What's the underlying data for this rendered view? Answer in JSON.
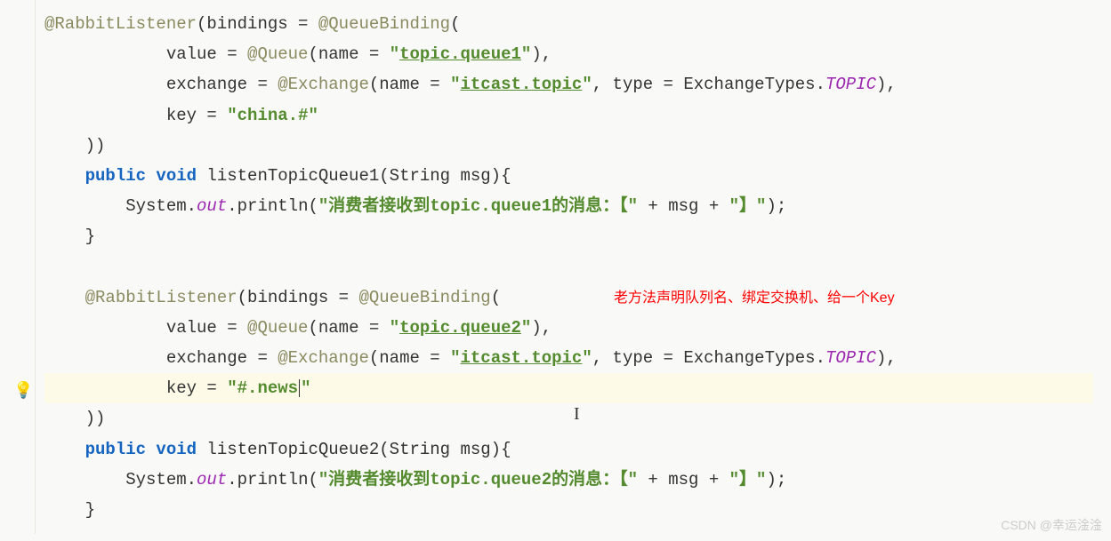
{
  "code": {
    "line1_anno": "@RabbitListener",
    "line1_rest": "(bindings = ",
    "line1_anno2": "@QueueBinding",
    "line1_paren": "(",
    "line2_pre": "            value = ",
    "line2_anno": "@Queue",
    "line2_mid": "(name = ",
    "line2_str_q": "\"",
    "line2_str": "topic.queue1",
    "line2_end": "),",
    "line3_pre": "            exchange = ",
    "line3_anno": "@Exchange",
    "line3_mid": "(name = ",
    "line3_str_q": "\"",
    "line3_str": "itcast.topic",
    "line3_mid2": ", type = ExchangeTypes.",
    "line3_topic": "TOPIC",
    "line3_end": "),",
    "line4_pre": "            key = ",
    "line4_str": "\"china.#\"",
    "line5": "    ))",
    "line6_kw": "public void",
    "line6_rest": " listenTopicQueue1(String msg){",
    "line7_pre": "        System.",
    "line7_out": "out",
    "line7_mid": ".println(",
    "line7_str": "\"消费者接收到topic.queue1的消息：【\"",
    "line7_mid2": " + msg + ",
    "line7_str2": "\"】\"",
    "line7_end": ");",
    "line8": "    }",
    "line9": "",
    "line10_anno": "@RabbitListener",
    "line10_rest": "(bindings = ",
    "line10_anno2": "@QueueBinding",
    "line10_paren": "(",
    "line11_pre": "            value = ",
    "line11_anno": "@Queue",
    "line11_mid": "(name = ",
    "line11_str": "topic.queue2",
    "line11_end": "),",
    "line12_pre": "            exchange = ",
    "line12_anno": "@Exchange",
    "line12_mid": "(name = ",
    "line12_str": "itcast.topic",
    "line12_mid2": ", type = ExchangeTypes.",
    "line12_topic": "TOPIC",
    "line12_end": "),",
    "line13_pre": "            key = ",
    "line13_str": "\"#.news",
    "line13_str_end": "\"",
    "line14": "    ))",
    "line15_kw": "public void",
    "line15_rest": " listenTopicQueue2(String msg){",
    "line16_pre": "        System.",
    "line16_out": "out",
    "line16_mid": ".println(",
    "line16_str": "\"消费者接收到topic.queue2的消息：【\"",
    "line16_mid2": " + msg + ",
    "line16_str2": "\"】\"",
    "line16_end": ");",
    "line17": "    }"
  },
  "annotation": "老方法声明队列名、绑定交换机、给一个Key",
  "watermark": "CSDN @幸运淦淦"
}
